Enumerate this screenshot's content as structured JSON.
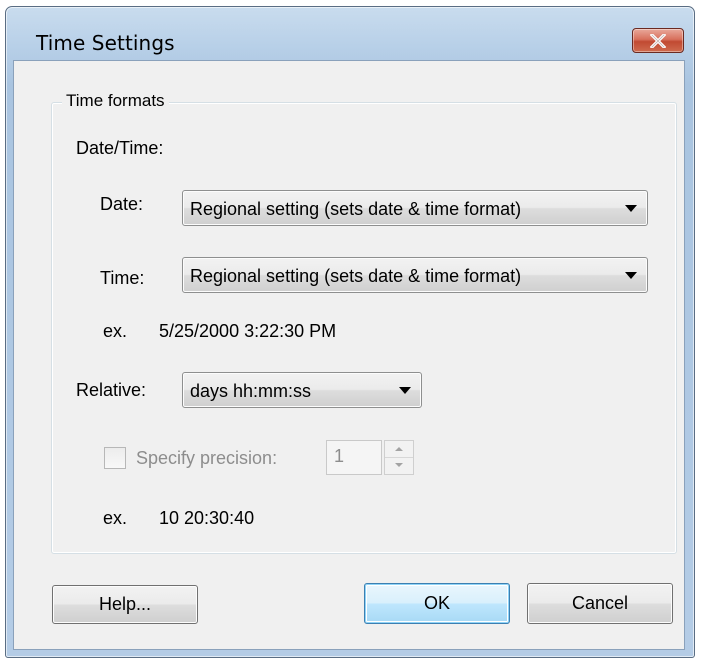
{
  "window": {
    "title": "Time Settings",
    "close_icon": "close-icon"
  },
  "group": {
    "legend": "Time formats",
    "datetime_heading": "Date/Time:",
    "date_label": "Date:",
    "date_value": "Regional setting (sets date & time format)",
    "time_label": "Time:",
    "time_value": "Regional setting (sets date & time format)",
    "datetime_example_prefix": "ex.",
    "datetime_example_value": "5/25/2000 3:22:30 PM",
    "relative_label": "Relative:",
    "relative_value": "days hh:mm:ss",
    "precision_label": "Specify precision:",
    "precision_checked": false,
    "precision_value": "1",
    "relative_example_prefix": "ex.",
    "relative_example_value": "10 20:30:40"
  },
  "buttons": {
    "help": "Help...",
    "ok": "OK",
    "cancel": "Cancel"
  },
  "colors": {
    "title_bar": "#b4cce6",
    "client_bg": "#f0f0f0",
    "close_button": "#c8533a",
    "default_button_border": "#3c7fb1",
    "disabled_text": "#8d8d8d"
  }
}
